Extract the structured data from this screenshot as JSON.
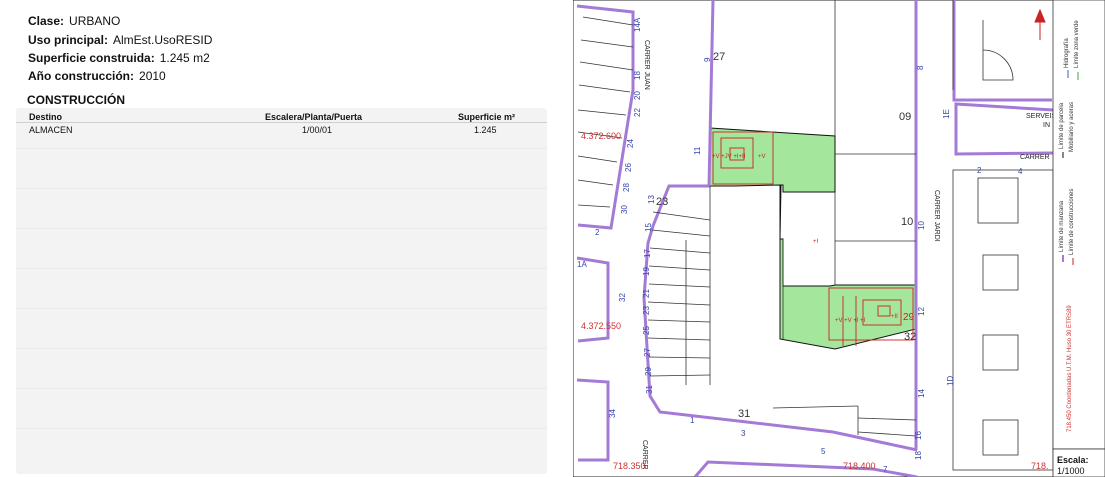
{
  "attributes": {
    "clase_label": "Clase:",
    "clase_value": "URBANO",
    "uso_label": "Uso principal:",
    "uso_value": "AlmEst.UsoRESID",
    "superficie_label": "Superficie construida:",
    "superficie_value": "1.245 m2",
    "anio_label": "Año construcción:",
    "anio_value": "2010"
  },
  "construccion": {
    "title": "CONSTRUCCIÓN",
    "headers": [
      "Destino",
      "Escalera/Planta/Puerta",
      "Superficie m²"
    ],
    "rows": [
      [
        "ALMACEN",
        "1/00/01",
        "1.245"
      ]
    ]
  },
  "map": {
    "house_numbers": [
      "27",
      "09",
      "23",
      "10",
      "32",
      "31",
      "11",
      "13",
      "15",
      "17",
      "19",
      "21",
      "23",
      "25",
      "27",
      "29",
      "31",
      "9",
      "8",
      "10",
      "12",
      "14",
      "16",
      "18",
      "22",
      "20",
      "18",
      "24",
      "26",
      "28",
      "30",
      "32",
      "34",
      "2",
      "4",
      "2",
      "5",
      "7",
      "1",
      "3",
      "14A",
      "1A",
      "1D",
      "1E"
    ],
    "street_labels": [
      "CARRER JUAN",
      "CARRER",
      "CARRER JARDI",
      "CARRER",
      "SERVEIS",
      "IN"
    ],
    "coords": [
      "4.372.600",
      "4.372.550",
      "718.350",
      "718.400",
      "718."
    ],
    "parcel_code": "29"
  },
  "legend": {
    "items": [
      "Límite de manzana",
      "Límite de parcela",
      "Límite de construcciones",
      "Mobiliario y aceras",
      "Límite zona verde",
      "Hidrografía"
    ],
    "crs": "718.450 Coordenadas U.T.M. Huso 30 ETRS89",
    "scale_label": "Escala:",
    "scale_value": "1/1000"
  },
  "colors": {
    "block_line": "#a37ad6",
    "parcel_line": "#111111",
    "building_line": "#cc2222",
    "green_fill": "#a4e69b",
    "coord_text": "#cc3333",
    "number_text": "#3344aa"
  }
}
